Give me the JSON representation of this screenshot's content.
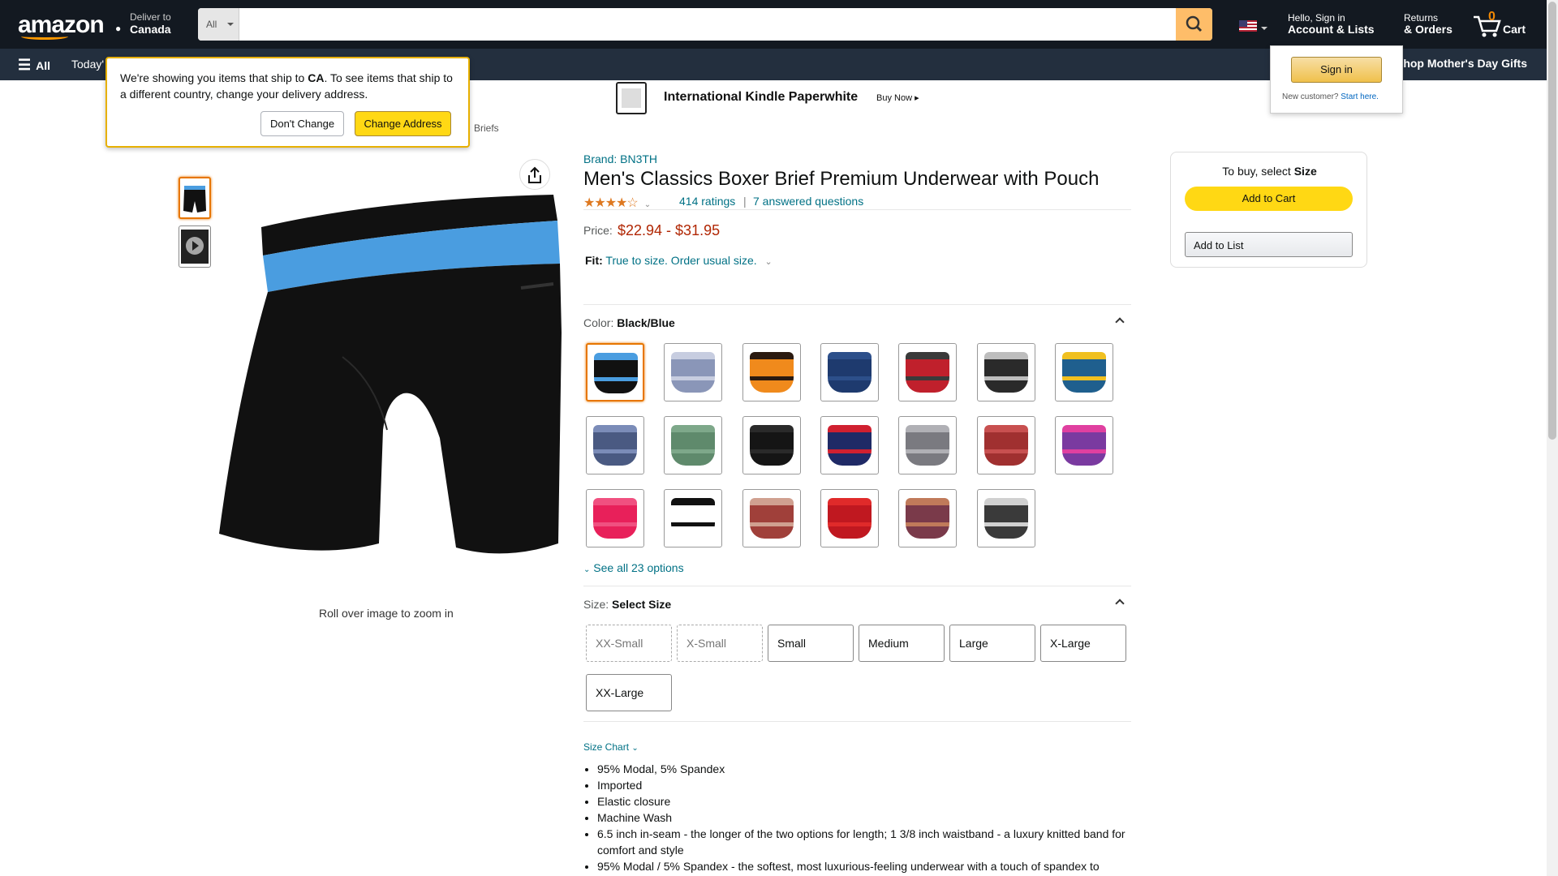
{
  "header": {
    "logo": "amazon",
    "deliver_to_label": "Deliver to",
    "deliver_to_country": "Canada",
    "search_category": "All",
    "search_placeholder": "",
    "account_greeting": "Hello, Sign in",
    "account_label": "Account & Lists",
    "returns_label": "Returns",
    "orders_label": "& Orders",
    "cart_count": "0",
    "cart_label": "Cart"
  },
  "nav": {
    "all": "All",
    "today": "Today'",
    "mothers_day": "Shop Mother's Day Gifts"
  },
  "popover": {
    "message_pre": "We're showing you items that ship to ",
    "message_country": "CA",
    "message_post": ". To see items that ship to a different country, change your delivery address.",
    "dont_change": "Don't Change",
    "change_address": "Change Address"
  },
  "signin_flyout": {
    "sign_in": "Sign in",
    "new_customer": "New customer?",
    "start_here": "Start here."
  },
  "banner": {
    "title": "International Kindle Paperwhite",
    "cta": "Buy Now"
  },
  "breadcrumb": "Briefs",
  "gallery": {
    "zoom_hint": "Roll over image to zoom in"
  },
  "product": {
    "brand": "Brand: BN3TH",
    "title": "Men's Classics Boxer Brief Premium Underwear with Pouch",
    "stars_glyphs": "★★★★☆",
    "rating_value": 4.5,
    "ratings": "414 ratings",
    "questions": "7 answered questions",
    "price_label": "Price:",
    "price": "$22.94 - $31.95",
    "fit_label": "Fit:",
    "fit_value": "True to size. Order usual size.",
    "color_label": "Color:",
    "color_value": "Black/Blue",
    "see_all": "See all 23 options",
    "size_label": "Size:",
    "size_value": "Select Size",
    "size_chart": "Size Chart",
    "sizes": [
      "XX-Small",
      "X-Small",
      "Small",
      "Medium",
      "Large",
      "X-Large",
      "XX-Large"
    ],
    "bullets": [
      "95% Modal, 5% Spandex",
      "Imported",
      "Elastic closure",
      "Machine Wash",
      "6.5 inch in-seam - the longer of the two options for length; 1 3/8 inch waistband - a luxury knitted band for comfort and style",
      "95% Modal / 5% Spandex - the softest, most luxurious-feeling underwear with a touch of spandex to"
    ]
  },
  "buybox": {
    "to_buy": "To buy, select ",
    "to_buy_bold": "Size",
    "add_to_cart": "Add to Cart",
    "add_to_list": "Add to List"
  },
  "swatch_colors": [
    [
      "#111111",
      "#4a9de0"
    ],
    [
      "#8a96b8",
      "#c7cde0"
    ],
    [
      "#f08a1c",
      "#2a1a10"
    ],
    [
      "#1e3a6e",
      "#2c4f8a"
    ],
    [
      "#c0202c",
      "#3a3a3a"
    ],
    [
      "#2a2a2a",
      "#bdbdbd"
    ],
    [
      "#1f5f8e",
      "#f0c020"
    ],
    [
      "#4a5a82",
      "#7b8cb8"
    ],
    [
      "#5f8a6c",
      "#7ea88a"
    ],
    [
      "#151515",
      "#2a2a2a"
    ],
    [
      "#1f2a66",
      "#d02030"
    ],
    [
      "#7a7a80",
      "#b0b0b5"
    ],
    [
      "#a03030",
      "#c85050"
    ],
    [
      "#7a3aa0",
      "#e040a0"
    ],
    [
      "#e8205a",
      "#f05080"
    ],
    [
      "#ffffff",
      "#111111"
    ],
    [
      "#a0403a",
      "#d0a090"
    ],
    [
      "#c01820",
      "#e02a2a"
    ],
    [
      "#7a3a4a",
      "#c07a5a"
    ],
    [
      "#3a3a3a",
      "#d0d0d0"
    ]
  ]
}
